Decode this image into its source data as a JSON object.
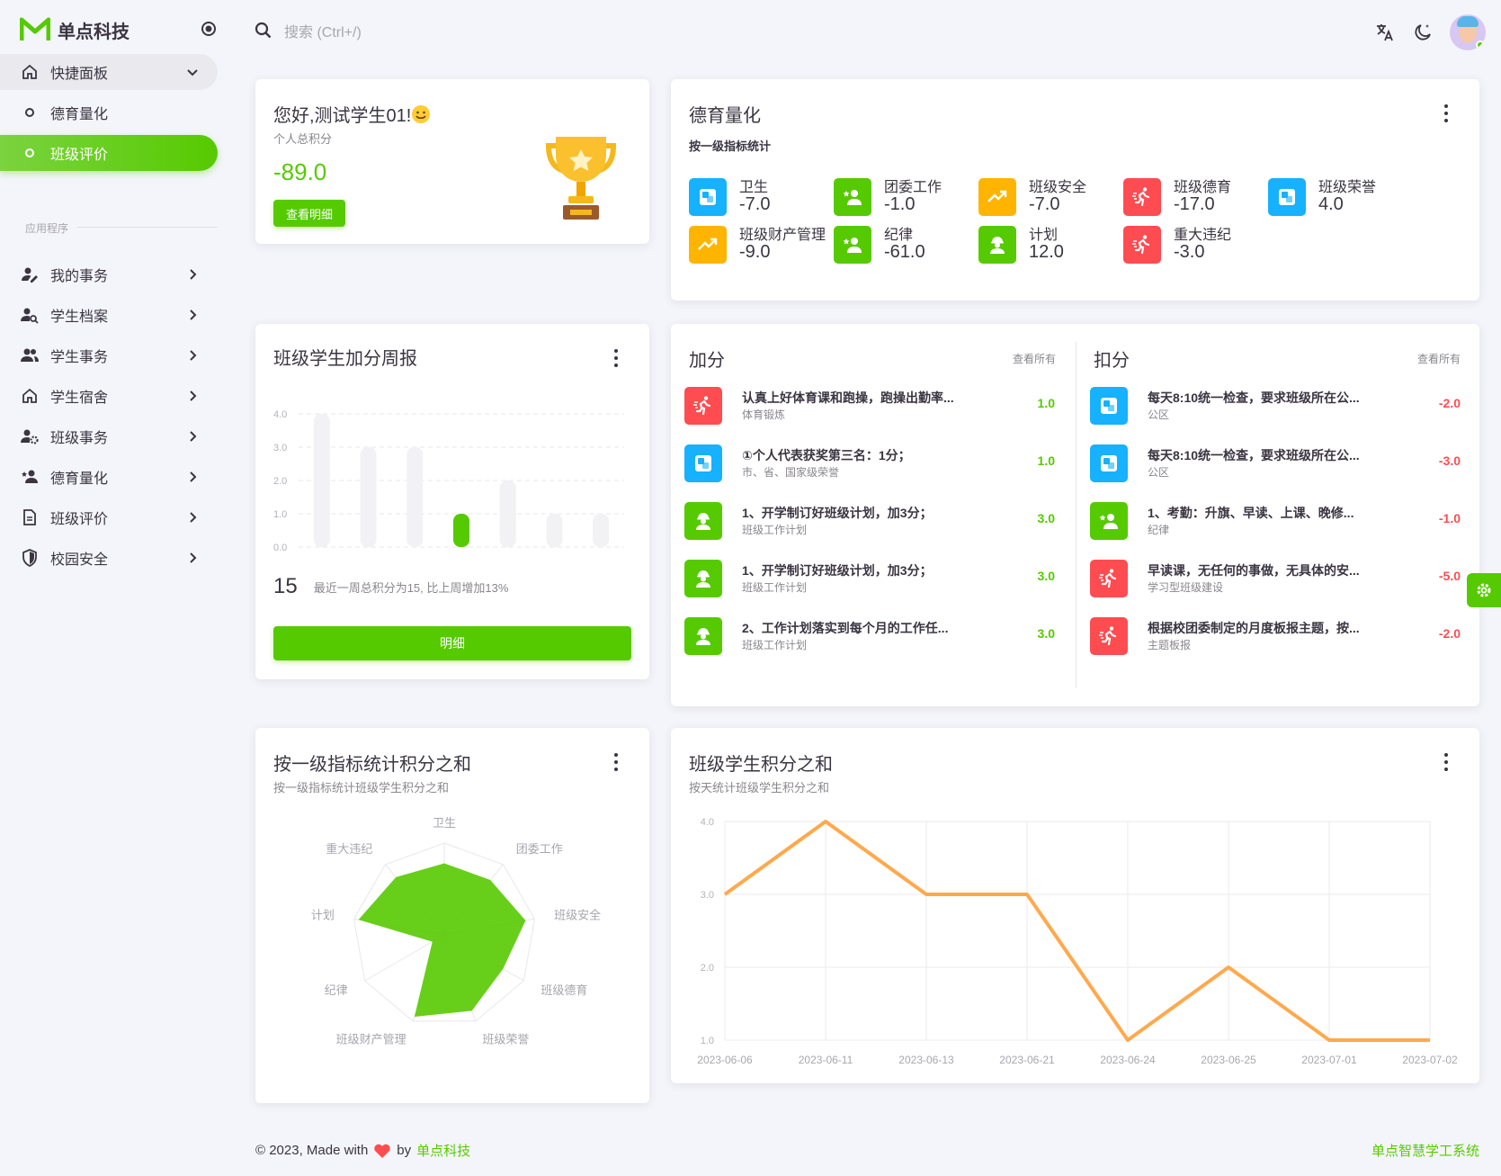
{
  "app": {
    "name": "单点科技"
  },
  "search": {
    "placeholder": "搜索 (Ctrl+/)"
  },
  "sidebar": {
    "dashboard": "快捷面板",
    "sub_items": [
      "德育量化",
      "班级评价"
    ],
    "section_label": "应用程序",
    "items": [
      "我的事务",
      "学生档案",
      "学生事务",
      "学生宿舍",
      "班级事务",
      "德育量化",
      "班级评价",
      "校园安全"
    ]
  },
  "welcome": {
    "greeting": "您好,测试学生01!",
    "sub": "个人总积分",
    "score": "-89.0",
    "button": "查看明细"
  },
  "quant": {
    "title": "德育量化",
    "subtitle": "按一级指标统计",
    "stats": [
      {
        "name": "卫生",
        "value": "-7.0",
        "color": "#16b1ff",
        "icon": "square-icon"
      },
      {
        "name": "团委工作",
        "value": "-1.0",
        "color": "#56ca00",
        "icon": "user-star-icon"
      },
      {
        "name": "班级安全",
        "value": "-7.0",
        "color": "#ffb400",
        "icon": "trend-icon"
      },
      {
        "name": "班级德育",
        "value": "-17.0",
        "color": "#ff4c51",
        "icon": "run-icon"
      },
      {
        "name": "班级荣誉",
        "value": "4.0",
        "color": "#16b1ff",
        "icon": "square-icon"
      },
      {
        "name": "班级财产管理",
        "value": "-9.0",
        "color": "#ffb400",
        "icon": "trend-icon"
      },
      {
        "name": "纪律",
        "value": "-61.0",
        "color": "#56ca00",
        "icon": "user-star-icon"
      },
      {
        "name": "计划",
        "value": "12.0",
        "color": "#56ca00",
        "icon": "worker-icon"
      },
      {
        "name": "重大违纪",
        "value": "-3.0",
        "color": "#ff4c51",
        "icon": "run-icon"
      }
    ]
  },
  "weekly": {
    "title": "班级学生加分周报",
    "total": "15",
    "desc": "最近一周总积分为15, 比上周增加13%",
    "button": "明细"
  },
  "weekly_chart": {
    "type": "bar",
    "yticks": [
      "4.0",
      "3.0",
      "2.0",
      "1.0",
      "0.0"
    ],
    "values": [
      4,
      3,
      3,
      1,
      2,
      1,
      1
    ],
    "highlight_index": 3
  },
  "plus": {
    "title": "加分",
    "view_all": "查看所有",
    "items": [
      {
        "t1": "认真上好体育课和跑操，跑操出勤率...",
        "t2": "体育锻炼",
        "v": "1.0",
        "color": "#ff4c51",
        "icon": "run-icon"
      },
      {
        "t1": "①个人代表获奖第三名：1分；",
        "t2": "市、省、国家级荣誉",
        "v": "1.0",
        "color": "#16b1ff",
        "icon": "square-icon"
      },
      {
        "t1": "1、开学制订好班级计划，加3分；",
        "t2": "班级工作计划",
        "v": "3.0",
        "color": "#56ca00",
        "icon": "worker-icon"
      },
      {
        "t1": "1、开学制订好班级计划，加3分；",
        "t2": "班级工作计划",
        "v": "3.0",
        "color": "#56ca00",
        "icon": "worker-icon"
      },
      {
        "t1": "2、工作计划落实到每个月的工作任...",
        "t2": "班级工作计划",
        "v": "3.0",
        "color": "#56ca00",
        "icon": "worker-icon"
      }
    ]
  },
  "minus": {
    "title": "扣分",
    "view_all": "查看所有",
    "items": [
      {
        "t1": "每天8:10统一检查，要求班级所在公...",
        "t2": "公区",
        "v": "-2.0",
        "color": "#16b1ff",
        "icon": "square-icon"
      },
      {
        "t1": "每天8:10统一检查，要求班级所在公...",
        "t2": "公区",
        "v": "-3.0",
        "color": "#16b1ff",
        "icon": "square-icon"
      },
      {
        "t1": "1、考勤：升旗、早读、上课、晚修...",
        "t2": "纪律",
        "v": "-1.0",
        "color": "#56ca00",
        "icon": "user-star-icon"
      },
      {
        "t1": "早读课，无任何的事做，无具体的安...",
        "t2": "学习型班级建设",
        "v": "-5.0",
        "color": "#ff4c51",
        "icon": "run-icon"
      },
      {
        "t1": "根据校团委制定的月度板报主题，按...",
        "t2": "主题板报",
        "v": "-2.0",
        "color": "#ff4c51",
        "icon": "run-icon"
      }
    ]
  },
  "radar": {
    "title": "按一级指标统计积分之和",
    "subtitle": "按一级指标统计班级学生积分之和"
  },
  "radar_chart": {
    "type": "radar",
    "labels": [
      "卫生",
      "团委工作",
      "班级安全",
      "班级德育",
      "班级荣誉",
      "班级财产管理",
      "纪律",
      "计划",
      "重大违纪"
    ],
    "values": [
      0.78,
      0.78,
      0.9,
      0.74,
      0.88,
      0.95,
      0.15,
      0.95,
      0.82
    ]
  },
  "line": {
    "title": "班级学生积分之和",
    "subtitle": "按天统计班级学生积分之和"
  },
  "line_chart": {
    "type": "line",
    "x": [
      "2023-06-06",
      "2023-06-11",
      "2023-06-13",
      "2023-06-21",
      "2023-06-24",
      "2023-06-25",
      "2023-07-01",
      "2023-07-02"
    ],
    "y": [
      3,
      4,
      3,
      3,
      1,
      2,
      1,
      1
    ],
    "yticks": [
      "4.0",
      "3.0",
      "2.0",
      "1.0"
    ],
    "ylim": [
      1,
      4
    ],
    "color": "#ffa94d"
  },
  "footer": {
    "left": "© 2023, Made with",
    "by": "by",
    "brand": "单点科技",
    "right": "单点智慧学工系统"
  }
}
